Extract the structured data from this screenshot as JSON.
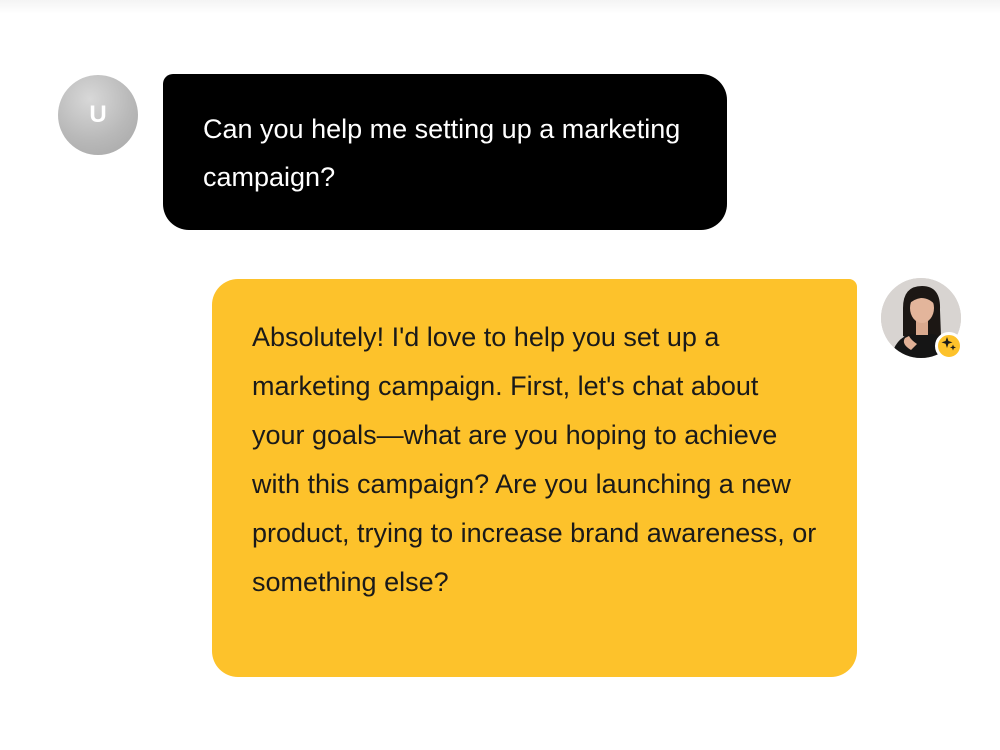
{
  "conversation": {
    "user_message": {
      "avatar_initial": "U",
      "text": "Can you help me setting up a marketing campaign?"
    },
    "assistant_message": {
      "avatar": "woman-portrait",
      "badge_icon": "sparkle-icon",
      "text": "Absolutely! I'd love to help you set up a marketing campaign. First, let's chat about your goals—what are you hoping to achieve with this campaign? Are you launching a new product, trying to increase brand awareness, or something else?"
    }
  },
  "colors": {
    "user_bubble": "#000000",
    "assistant_bubble": "#fdc22b",
    "user_avatar": "#b9b9b9"
  }
}
